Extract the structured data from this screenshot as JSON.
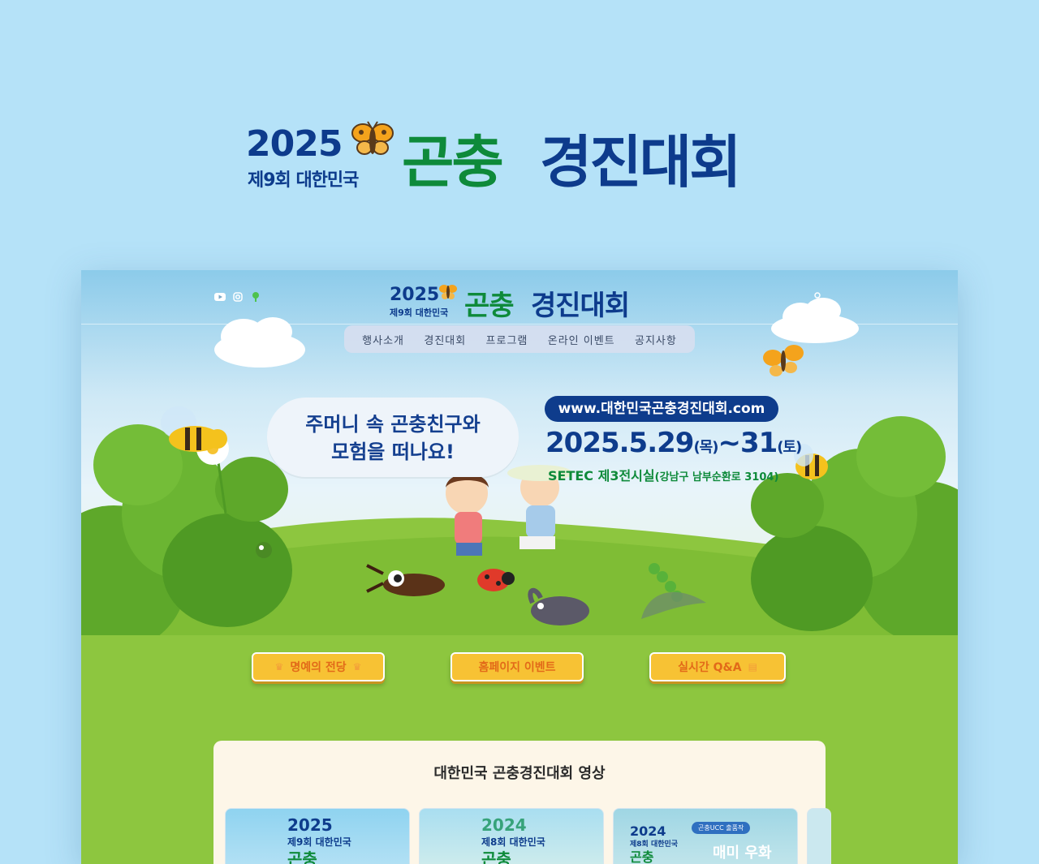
{
  "big_title": {
    "year": "2025",
    "subtitle": "제9회 대한민국",
    "green_text": "곤충",
    "blue_text": "경진대회"
  },
  "site": {
    "logo": {
      "year": "2025",
      "subtitle": "제9회 대한민국",
      "green_text": "곤충",
      "blue_text": "경진대회"
    },
    "nav": [
      "행사소개",
      "경진대회",
      "프로그램",
      "온라인 이벤트",
      "공지사항"
    ],
    "hero": {
      "bubble_line1": "주머니 속 곤충친구와",
      "bubble_line2": "모험을 떠나요!",
      "url": "www.대한민국곤충경진대회.com",
      "date_main": "2025.5.29",
      "date_day1": "(목)",
      "date_range": "~31",
      "date_day2": "(토)",
      "venue_main": "SETEC 제3전시실",
      "venue_detail": "(강남구 남부순환로 3104)"
    },
    "cta_buttons": [
      "명예의 전당",
      "홈페이지 이벤트",
      "실시간 Q&A"
    ],
    "video_section": {
      "title": "대한민국 곤충경진대회 영상",
      "thumbnails": [
        {
          "year": "2025",
          "subtitle": "제9회 대한민국",
          "green": "곤충"
        },
        {
          "year": "2024",
          "subtitle": "제8회 대한민국",
          "green": "곤충"
        },
        {
          "year": "2024",
          "subtitle": "제8회 대한민국",
          "green": "곤충",
          "tag": "곤충UCC 출품작",
          "headline": "매미 우화"
        }
      ]
    }
  },
  "colors": {
    "background": "#b5e2f8",
    "navy": "#0d3b8c",
    "green": "#0e8a3a",
    "cta_yellow": "#f7c234",
    "cta_text": "#e26a19"
  }
}
